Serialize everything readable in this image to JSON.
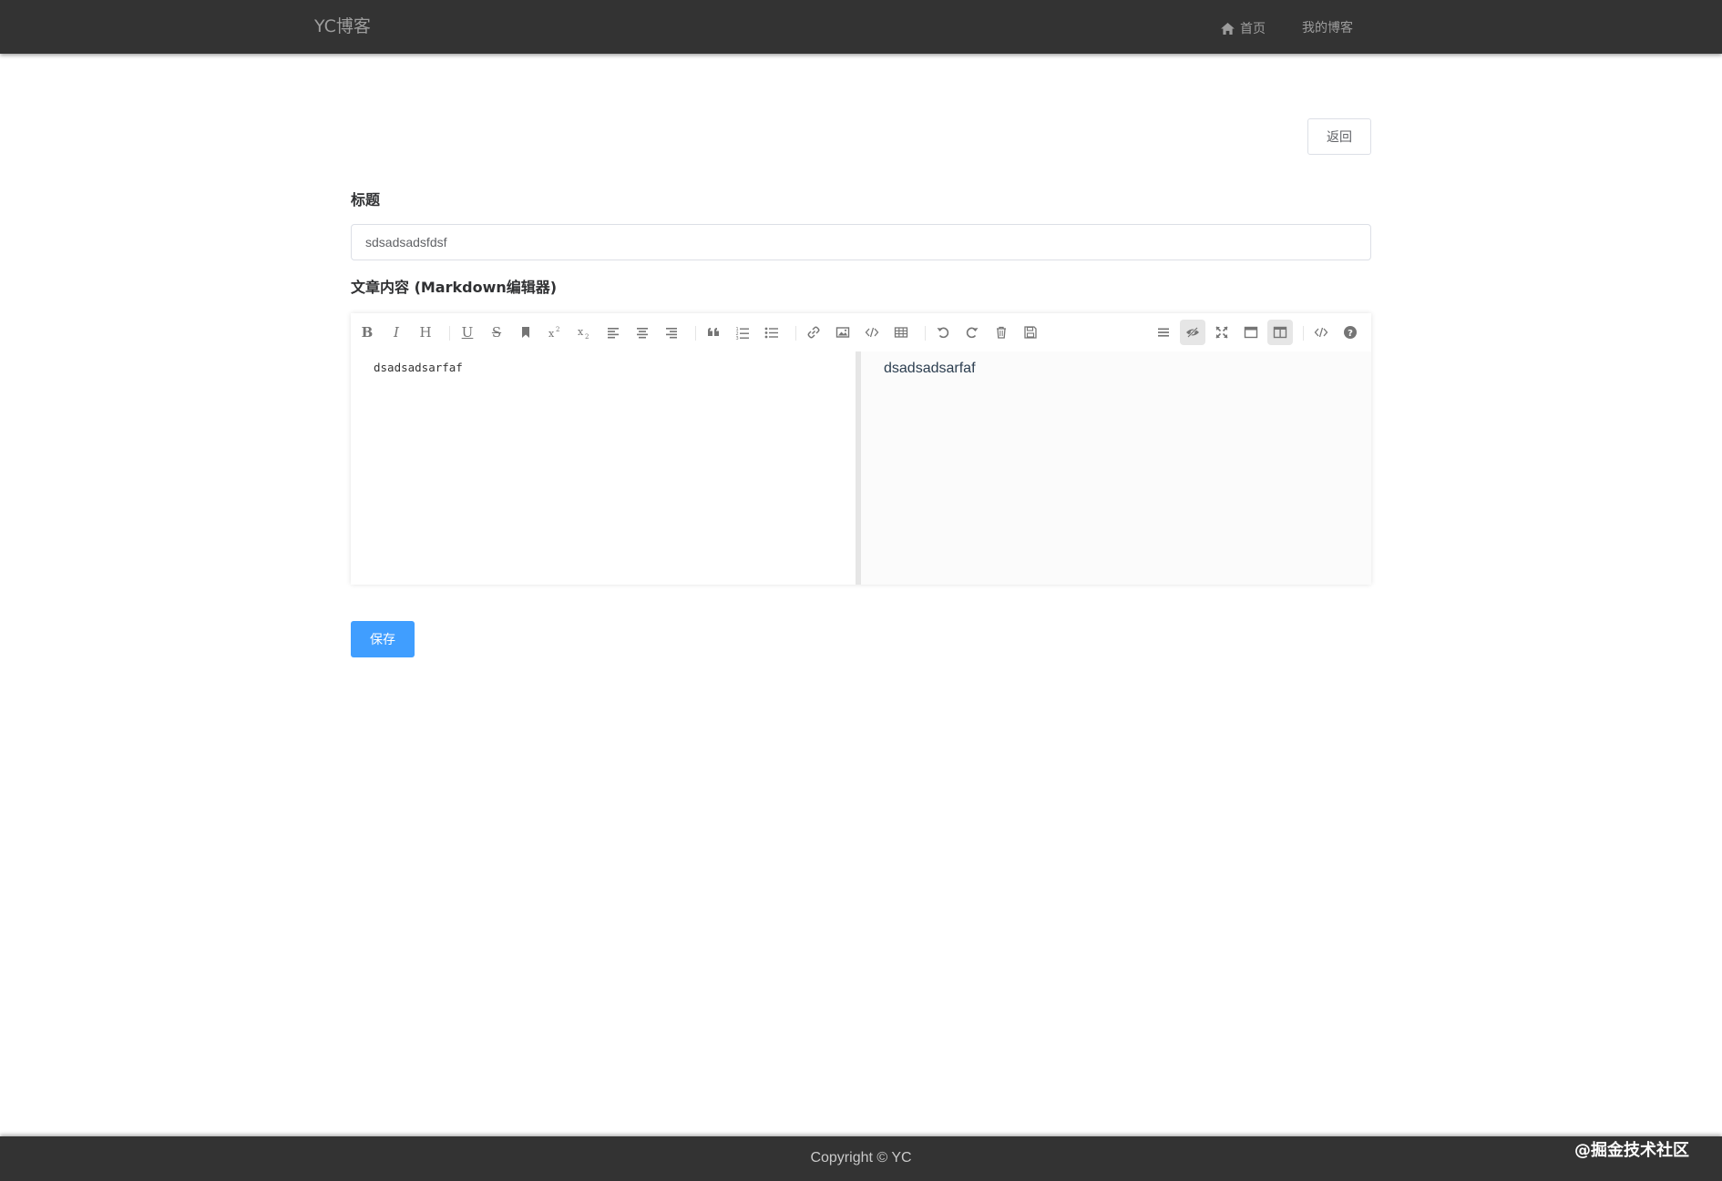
{
  "navbar": {
    "brand": "YC博客",
    "home_label": "首页",
    "myblog_label": "我的博客"
  },
  "actions": {
    "back_label": "返回",
    "save_label": "保存"
  },
  "form": {
    "title_label": "标题",
    "title_value": "sdsadsadsfdsf",
    "content_label": "文章内容 (Markdown编辑器)"
  },
  "editor": {
    "source_text": "dsadsadsarfaf",
    "preview_text": "dsadsadsarfaf",
    "toolbar_left": [
      "bold-icon",
      "italic-icon",
      "header-icon",
      "underline-icon",
      "strikethrough-icon",
      "mark-icon",
      "superscript-icon",
      "subscript-icon",
      "align-left-icon",
      "align-center-icon",
      "align-right-icon",
      "quote-icon",
      "ordered-list-icon",
      "unordered-list-icon",
      "link-icon",
      "image-icon",
      "code-icon",
      "table-icon",
      "undo-icon",
      "redo-icon",
      "trash-icon",
      "save-icon"
    ],
    "toolbar_right": [
      "navigation-icon",
      "preview-eye-icon",
      "fullscreen-icon",
      "read-mode-icon",
      "subfield-icon",
      "html-code-icon",
      "help-icon"
    ]
  },
  "footer": {
    "copyright": "Copyright © YC"
  },
  "watermark": "@掘金技术社区",
  "colors": {
    "navbar_bg": "#333333",
    "primary": "#409eff",
    "nav_text": "#9d9d9d"
  }
}
